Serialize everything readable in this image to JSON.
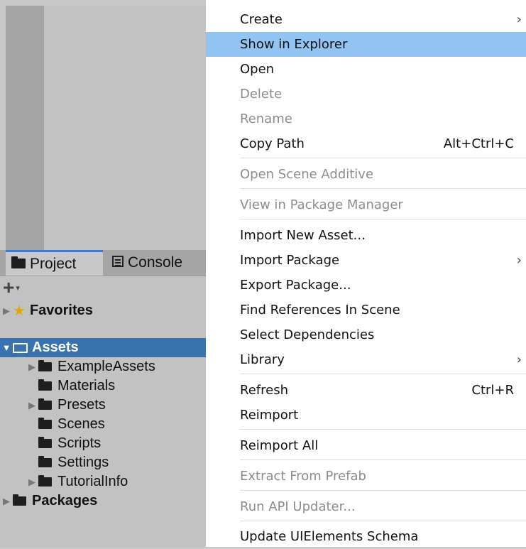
{
  "project_panel": {
    "tabs": [
      {
        "label": "Project",
        "icon": "folder-icon"
      },
      {
        "label": "Console",
        "icon": "console-icon"
      }
    ],
    "toolbar": {
      "add_symbol": "+",
      "dropdown_symbol": "▾"
    },
    "tree": [
      {
        "label": "Favorites",
        "bold": true,
        "icon": "star-icon",
        "expandable": true
      },
      {
        "label": "Assets",
        "bold": true,
        "icon": "folder-open-icon",
        "expanded": true,
        "selected": true
      },
      {
        "label": "ExampleAssets",
        "icon": "folder-icon",
        "expandable": true
      },
      {
        "label": "Materials",
        "icon": "folder-icon"
      },
      {
        "label": "Presets",
        "icon": "folder-icon",
        "expandable": true
      },
      {
        "label": "Scenes",
        "icon": "folder-icon"
      },
      {
        "label": "Scripts",
        "icon": "folder-icon"
      },
      {
        "label": "Settings",
        "icon": "folder-icon"
      },
      {
        "label": "TutorialInfo",
        "icon": "folder-icon",
        "expandable": true
      },
      {
        "label": "Packages",
        "bold": true,
        "icon": "folder-icon",
        "expandable": true
      }
    ]
  },
  "context_menu": {
    "items": [
      {
        "label": "Create",
        "submenu": true
      },
      {
        "label": "Show in Explorer",
        "highlighted": true
      },
      {
        "label": "Open"
      },
      {
        "label": "Delete",
        "disabled": true
      },
      {
        "label": "Rename",
        "disabled": true
      },
      {
        "label": "Copy Path",
        "shortcut": "Alt+Ctrl+C"
      },
      {
        "label": "Open Scene Additive",
        "disabled": true
      },
      {
        "label": "View in Package Manager",
        "disabled": true
      },
      {
        "label": "Import New Asset..."
      },
      {
        "label": "Import Package",
        "submenu": true
      },
      {
        "label": "Export Package..."
      },
      {
        "label": "Find References In Scene"
      },
      {
        "label": "Select Dependencies"
      },
      {
        "label": "Library",
        "submenu": true
      },
      {
        "label": "Refresh",
        "shortcut": "Ctrl+R"
      },
      {
        "label": "Reimport"
      },
      {
        "label": "Reimport All"
      },
      {
        "label": "Extract From Prefab",
        "disabled": true
      },
      {
        "label": "Run API Updater...",
        "disabled": true
      },
      {
        "label": "Update UIElements Schema"
      }
    ],
    "submenu_arrow": "›",
    "highlight_color": "#91c4f2",
    "disabled_color": "#8c8c8c"
  },
  "colors": {
    "selection": "#3a72b0",
    "tab_accent": "#3a7bd5",
    "star": "#e6a700"
  }
}
